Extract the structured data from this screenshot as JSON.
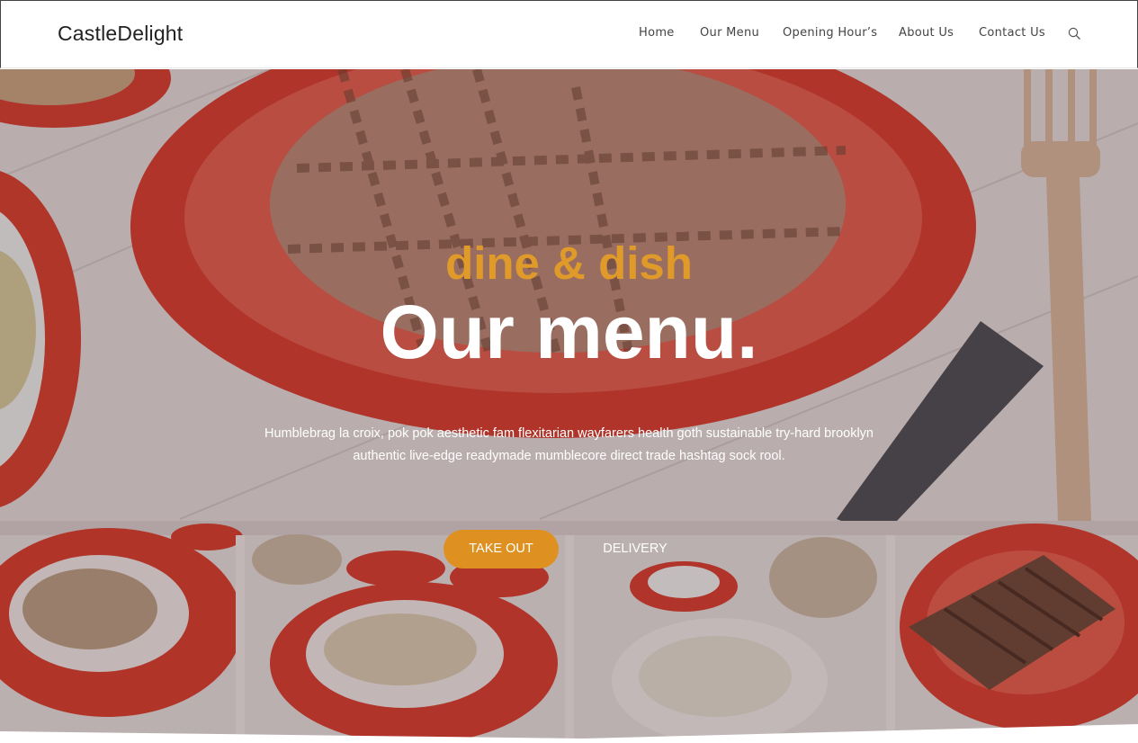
{
  "header": {
    "brand": "CastleDelight",
    "nav": [
      {
        "label": "Home"
      },
      {
        "label": "Our Menu"
      },
      {
        "label": "Opening Hour’s"
      },
      {
        "label": "About Us"
      },
      {
        "label": "Contact Us"
      }
    ],
    "search_icon": "search-icon"
  },
  "hero": {
    "tagline": "dine & dish",
    "title": "Our menu.",
    "description": "Humblebrag la croix, pok pok aesthetic fam flexitarian wayfarers health goth sustainable try-hard brooklyn authentic live-edge readymade mumblecore direct trade hashtag sock rool.",
    "buttons": {
      "takeout": "TAKE OUT",
      "delivery": "DELIVERY"
    }
  },
  "colors": {
    "accent": "#de9120",
    "tagline": "#e09a2a",
    "plate_red": "#d8372a",
    "text_dark": "#222222"
  }
}
